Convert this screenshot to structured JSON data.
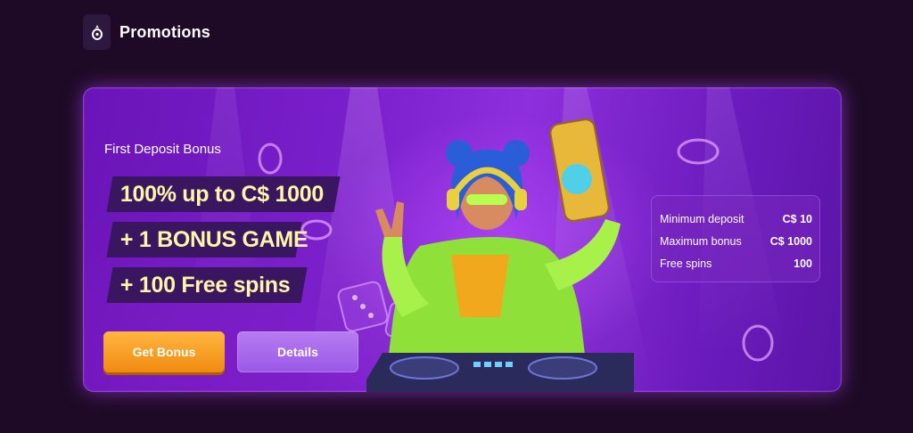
{
  "header": {
    "title": "Promotions",
    "icon": "pineapple-icon"
  },
  "banner": {
    "eyebrow": "First Deposit Bonus",
    "lines": [
      "100% up to C$ 1000",
      "+ 1 BONUS GAME",
      "+ 100 Free spins"
    ],
    "buttons": {
      "primary": "Get Bonus",
      "secondary": "Details"
    },
    "info": [
      {
        "label": "Minimum deposit",
        "value": "C$ 10"
      },
      {
        "label": "Maximum bonus",
        "value": "C$ 1000"
      },
      {
        "label": "Free spins",
        "value": "100"
      }
    ]
  },
  "colors": {
    "background": "#1e0a26",
    "headline": "#fff6a8",
    "primary_button": "#f59a1c",
    "secondary_button": "#a567ea"
  }
}
